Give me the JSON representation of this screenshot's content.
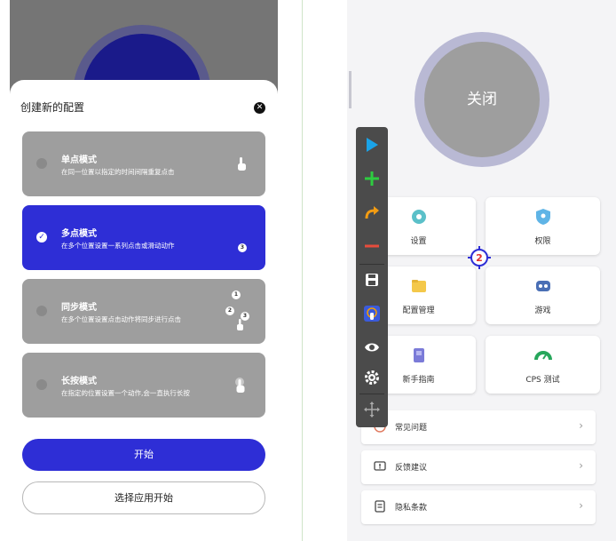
{
  "left": {
    "sheet_title": "创建新的配置",
    "modes": [
      {
        "name": "单点模式",
        "desc": "在同一位置以指定的时间间隔重复点击",
        "selected": false,
        "icon": "tap-hand-icon"
      },
      {
        "name": "多点模式",
        "desc": "在多个位置设置一系列点击或滑动动作",
        "selected": true,
        "icon": "numbered-badge-icon",
        "badge": "3"
      },
      {
        "name": "同步模式",
        "desc": "在多个位置设置点击动作将同步进行点击",
        "selected": false,
        "icon": "multi-tap-icon",
        "badges": [
          "1",
          "2",
          "3"
        ]
      },
      {
        "name": "长按模式",
        "desc": "在指定的位置设置一个动作,会一直执行长按",
        "selected": false,
        "icon": "long-press-hand-icon"
      }
    ],
    "start_label": "开始",
    "choose_label": "选择应用开始"
  },
  "right": {
    "power_label": "关闭",
    "tiles": [
      {
        "label": "设置",
        "icon": "gear-icon",
        "color": "#5bc0c9"
      },
      {
        "label": "权限",
        "icon": "shield-icon",
        "color": "#5fb4e6"
      },
      {
        "label": "配置管理",
        "icon": "folder-icon",
        "color": "#f4c84a"
      },
      {
        "label": "游戏",
        "icon": "gamepad-icon",
        "color": "#4a6fb5"
      },
      {
        "label": "新手指南",
        "icon": "book-icon",
        "color": "#7b7bd8"
      },
      {
        "label": "CPS 测试",
        "icon": "speedometer-icon",
        "color": "#26a65b"
      }
    ],
    "list": [
      {
        "label": "常见问题",
        "icon": "question-icon"
      },
      {
        "label": "反馈建议",
        "icon": "feedback-icon"
      },
      {
        "label": "隐私条款",
        "icon": "privacy-doc-icon"
      }
    ],
    "target_number": "2",
    "toolbar": [
      {
        "icon": "play-icon",
        "color": "#1aa3e8"
      },
      {
        "icon": "plus-icon",
        "color": "#2ecc40"
      },
      {
        "icon": "swipe-arrow-icon",
        "color": "#f39c12"
      },
      {
        "icon": "minus-icon",
        "color": "#e74c3c"
      },
      {
        "icon": "save-icon",
        "color": "#ffffff"
      },
      {
        "icon": "anti-detection-icon",
        "color": "#3b5bdb"
      },
      {
        "icon": "eye-icon",
        "color": "#ffffff"
      },
      {
        "icon": "gear-icon",
        "color": "#ffffff"
      },
      {
        "icon": "move-icon",
        "color": "#aaaaaa"
      }
    ]
  }
}
